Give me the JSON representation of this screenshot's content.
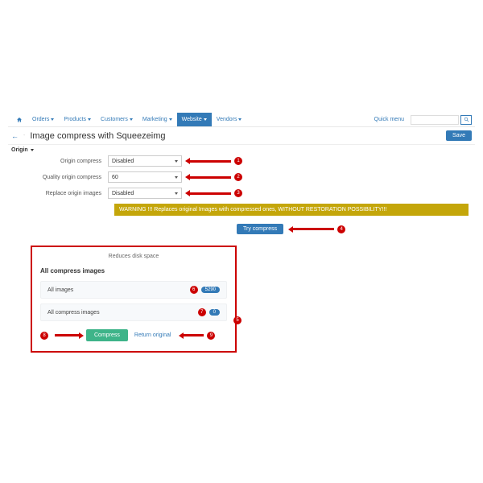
{
  "nav": {
    "orders": "Orders",
    "products": "Products",
    "customers": "Customers",
    "marketing": "Marketing",
    "website": "Website",
    "vendors": "Vendors",
    "quick": "Quick menu"
  },
  "page": {
    "title": "Image compress with Squeezeimg",
    "save": "Save",
    "origin": "Origin"
  },
  "form": {
    "origin_compress_label": "Origin compress",
    "origin_compress_value": "Disabled",
    "quality_label": "Quality origin compress",
    "quality_value": "60",
    "replace_label": "Replace origin images",
    "replace_value": "Disabled"
  },
  "warning": "WARNING !!! Replaces original Images with compressed ones, WITHOUT RESTORATION POSSIBILITY!!!",
  "try": "Try compress",
  "panel": {
    "title": "Reduces disk space",
    "heading": "All compress images",
    "all_images": "All images",
    "all_images_count": "5290",
    "all_compress": "All compress images",
    "all_compress_count": "0",
    "compress": "Compress",
    "return": "Return original"
  },
  "pts": {
    "p1": "1",
    "p2": "2",
    "p3": "3",
    "p4": "4",
    "p5": "5",
    "p6": "6",
    "p7": "7",
    "p8": "8",
    "p9": "9"
  }
}
